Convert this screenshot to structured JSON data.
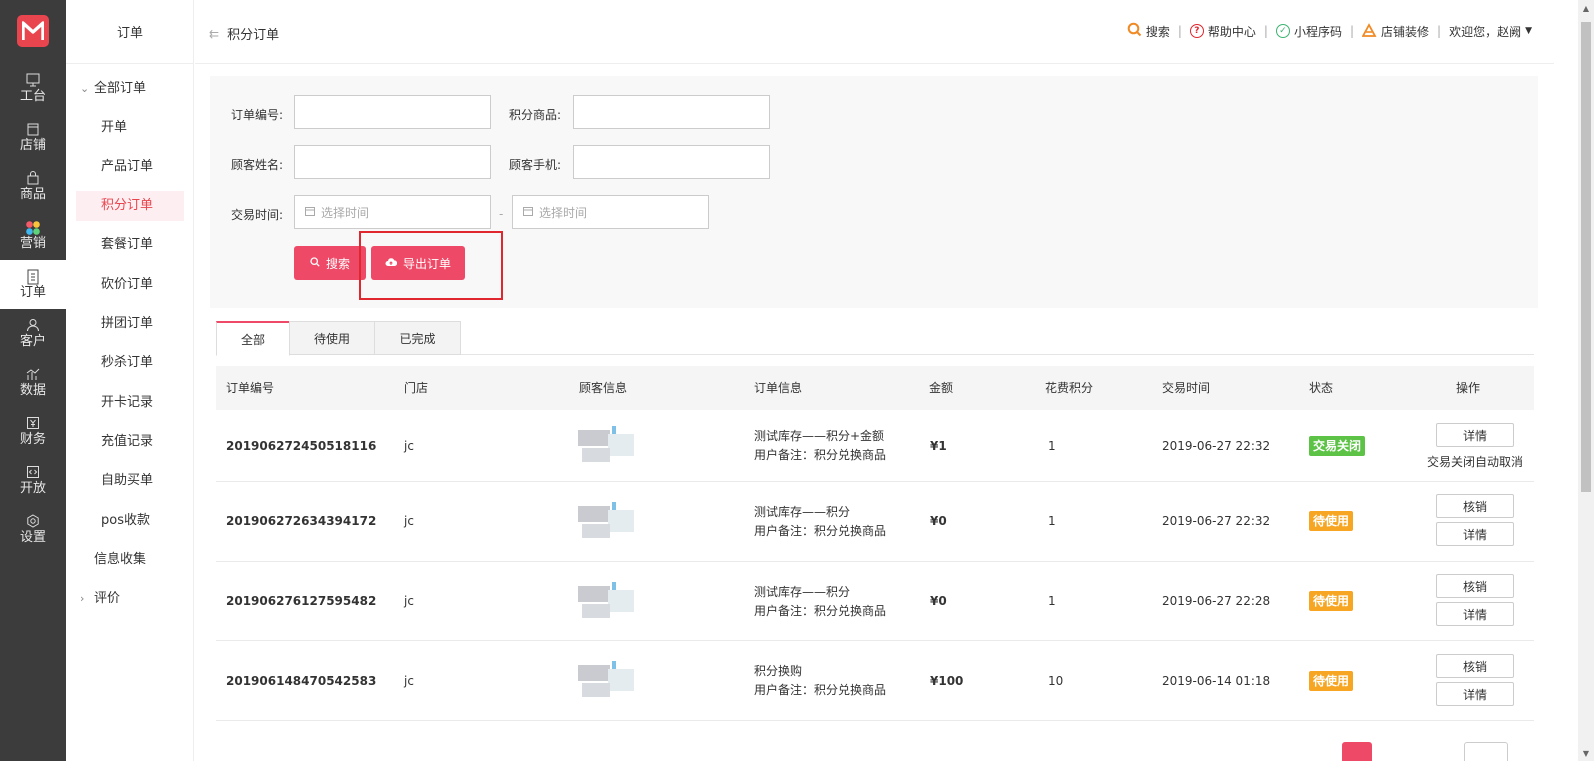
{
  "rail": {
    "items": [
      {
        "label": "工台",
        "icon": "monitor-icon"
      },
      {
        "label": "店铺",
        "icon": "shop-icon"
      },
      {
        "label": "商品",
        "icon": "bag-icon"
      },
      {
        "label": "营销",
        "icon": "marketing-icon"
      },
      {
        "label": "订单",
        "icon": "order-icon",
        "active": true
      },
      {
        "label": "客户",
        "icon": "user-icon"
      },
      {
        "label": "数据",
        "icon": "chart-icon"
      },
      {
        "label": "财务",
        "icon": "finance-icon"
      },
      {
        "label": "开放",
        "icon": "code-icon"
      },
      {
        "label": "设置",
        "icon": "gear-icon"
      }
    ]
  },
  "submenu": {
    "title": "订单",
    "group_all": "全部订单",
    "items": [
      "开单",
      "产品订单",
      "积分订单",
      "套餐订单",
      "砍价订单",
      "拼团订单",
      "秒杀订单",
      "开卡记录",
      "充值记录",
      "自助买单",
      "pos收款"
    ],
    "info_collect": "信息收集",
    "group_review": "评价"
  },
  "header": {
    "breadcrumb": "积分订单",
    "search": "搜索",
    "help": "帮助中心",
    "miniapp": "小程序码",
    "decorate": "店铺装修",
    "welcome": "欢迎您，赵阙"
  },
  "filter": {
    "order_no_label": "订单编号:",
    "goods_label": "积分商品:",
    "name_label": "顾客姓名:",
    "phone_label": "顾客手机:",
    "time_label": "交易时间:",
    "start_placeholder": "选择时间",
    "end_placeholder": "选择时间",
    "dash": "-",
    "search_btn": "搜索",
    "export_btn": "导出订单"
  },
  "tabs": [
    "全部",
    "待使用",
    "已完成"
  ],
  "table": {
    "headers": [
      "订单编号",
      "门店",
      "顾客信息",
      "订单信息",
      "金额",
      "花费积分",
      "交易时间",
      "状态",
      "操作"
    ],
    "rows": [
      {
        "no": "201906272450518116",
        "store": "jc",
        "info1": "测试库存——积分+金额",
        "info2": "用户备注：积分兑换商品",
        "amount": "¥1",
        "points": "1",
        "time": "2019-06-27 22:32",
        "status": "交易关闭",
        "status_type": "closed",
        "actions": [
          "详情"
        ],
        "note": "交易关闭自动取消"
      },
      {
        "no": "201906272634394172",
        "store": "jc",
        "info1": "测试库存——积分",
        "info2": "用户备注：积分兑换商品",
        "amount": "¥0",
        "points": "1",
        "time": "2019-06-27 22:32",
        "status": "待使用",
        "status_type": "pending",
        "actions": [
          "核销",
          "详情"
        ]
      },
      {
        "no": "201906276127595482",
        "store": "jc",
        "info1": "测试库存——积分",
        "info2": "用户备注：积分兑换商品",
        "amount": "¥0",
        "points": "1",
        "time": "2019-06-27 22:28",
        "status": "待使用",
        "status_type": "pending",
        "actions": [
          "核销",
          "详情"
        ]
      },
      {
        "no": "201906148470542583",
        "store": "jc",
        "info1": "积分换购",
        "info2": "用户备注：积分兑换商品",
        "amount": "¥100",
        "points": "10",
        "time": "2019-06-14 01:18",
        "status": "待使用",
        "status_type": "pending",
        "actions": [
          "核销",
          "详情"
        ]
      }
    ]
  },
  "colors": {
    "accent": "#ee4a67",
    "rail": "#3c3c3c",
    "closed": "#5cc346",
    "pending": "#f6a623"
  }
}
